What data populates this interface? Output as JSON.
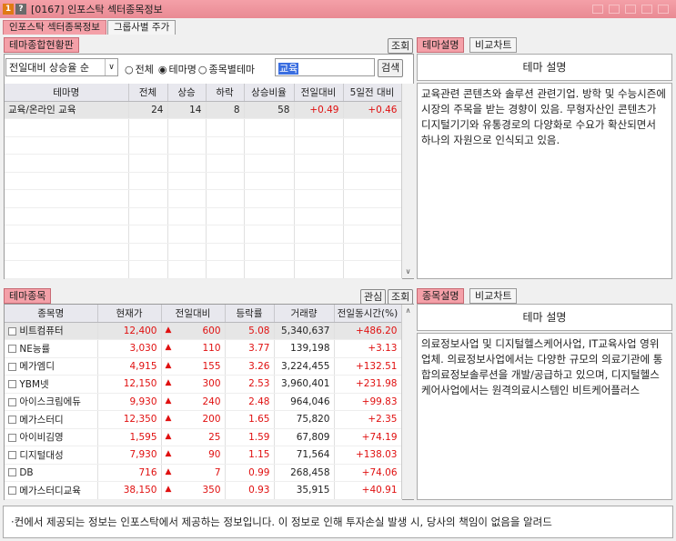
{
  "window": {
    "icon1": "1",
    "icon2": "?",
    "title": "[0167] 인포스탁 섹터종목정보"
  },
  "top_tabs": [
    "인포스탁 섹터종목정보",
    "그룹사별 주가"
  ],
  "theme_board": {
    "tab": "테마종합현황판",
    "query_btn": "조회",
    "sort_select": "전일대비 상승율 순",
    "radio_all": "전체",
    "radio_theme": "테마명",
    "radio_stock": "종목별테마",
    "search_value": "교육",
    "search_btn": "검색",
    "columns": [
      "테마명",
      "전체",
      "상승",
      "하락",
      "상승비율",
      "전일대비",
      "5일전 대비"
    ],
    "rows": [
      [
        "교육/온라인 교육",
        "24",
        "14",
        "8",
        "58",
        "+0.49",
        "+0.46"
      ]
    ]
  },
  "theme_desc": {
    "tab_active": "테마설명",
    "tab_other": "비교차트",
    "header": "테마 설명",
    "text": "교육관련 콘텐츠와 솔루션 관련기업. 방학 및 수능시즌에 시장의 주목을 받는 경향이 있음. 무형자산인 콘텐츠가 디지털기기와 유통경로의 다양화로 수요가 확산되면서 하나의 자원으로 인식되고 있음."
  },
  "stocks": {
    "tab": "테마종목",
    "fav_btn": "관심",
    "query_btn": "조회",
    "columns": [
      "종목명",
      "현재가",
      "전일대비",
      "등락률",
      "거래량",
      "전일동시간(%)"
    ],
    "rows": [
      [
        "비트컴퓨터",
        "12,400",
        "600",
        "5.08",
        "5,340,637",
        "+486.20"
      ],
      [
        "NE능률",
        "3,030",
        "110",
        "3.77",
        "139,198",
        "+3.13"
      ],
      [
        "메가엠디",
        "4,915",
        "155",
        "3.26",
        "3,224,455",
        "+132.51"
      ],
      [
        "YBM넷",
        "12,150",
        "300",
        "2.53",
        "3,960,401",
        "+231.98"
      ],
      [
        "아이스크림에듀",
        "9,930",
        "240",
        "2.48",
        "964,046",
        "+99.83"
      ],
      [
        "메가스터디",
        "12,350",
        "200",
        "1.65",
        "75,820",
        "+2.35"
      ],
      [
        "아이비김영",
        "1,595",
        "25",
        "1.59",
        "67,809",
        "+74.19"
      ],
      [
        "디지털대성",
        "7,930",
        "90",
        "1.15",
        "71,564",
        "+138.03"
      ],
      [
        "DB",
        "716",
        "7",
        "0.99",
        "268,458",
        "+74.06"
      ],
      [
        "메가스터디교육",
        "38,150",
        "350",
        "0.93",
        "35,915",
        "+40.91"
      ]
    ],
    "up_symbol": "▲"
  },
  "stock_desc": {
    "tab_active": "종목설명",
    "tab_other": "비교차트",
    "header": "테마 설명",
    "text": "의료정보사업 및 디지털헬스케어사업, IT교육사업 영위업체. 의료정보사업에서는 다양한 규모의 의료기관에 통합의료정보솔루션을 개발/공급하고 있으며, 디지털헬스케어사업에서는 원격의료시스템인 비트케어플러스"
  },
  "footer": "·컨에서 제공되는 정보는 인포스탁에서 제공하는 정보입니다. 이 정보로 인해 투자손실 발생 시, 당사의 책임이 없음을 알려드"
}
